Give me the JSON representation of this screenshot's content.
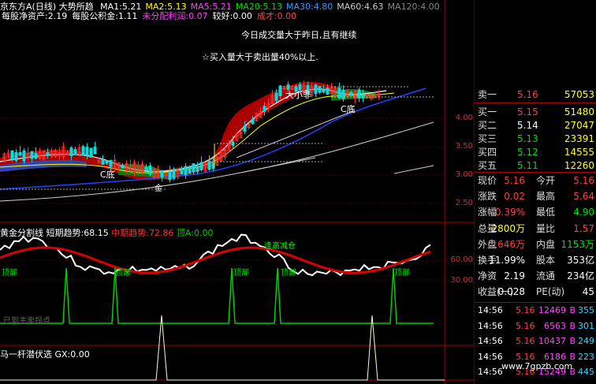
{
  "header": {
    "name": "京东方A(日线)",
    "trend": "大势所趋",
    "ma": [
      {
        "label": "MA1:",
        "value": "5.21",
        "color": "#ffffff"
      },
      {
        "label": "MA2:",
        "value": "5.13",
        "color": "#ffff00"
      },
      {
        "label": "MA5:",
        "value": "5.21",
        "color": "#ff44ff"
      },
      {
        "label": "MA20:",
        "value": "5.13",
        "color": "#00dd00"
      },
      {
        "label": "MA30:",
        "value": "4.80",
        "color": "#3399ff"
      },
      {
        "label": "MA60:",
        "value": "4.63",
        "color": "#cccccc"
      },
      {
        "label": "MA120:",
        "value": "4.00",
        "color": "#888888"
      }
    ],
    "row2": [
      {
        "label": "每股净资产:",
        "value": "2.19",
        "color": "#ffffff"
      },
      {
        "label": "每股公积金:",
        "value": "1.11",
        "color": "#ffffff"
      },
      {
        "label": "未分配利润:",
        "value": "0.07",
        "color": "#ff44ff"
      },
      {
        "label": "较好:",
        "value": "0.00",
        "color": "#ffffff"
      },
      {
        "label": "成才:",
        "value": "0.00",
        "color": "#ff4444"
      }
    ]
  },
  "annotations": {
    "volume_note": "今日成交量大于昨日,且有继续",
    "buy_note": "☆买入量大于卖出量40%以上.",
    "bigbig": "大小非",
    "c_bottom": "C底",
    "gold": "金"
  },
  "price_ticks": [
    "4.00",
    "3.50",
    "3.00",
    "2.50"
  ],
  "indicator": {
    "title": "黄金分割线",
    "trend_label": "短期趋势:",
    "trend_value": "68.15",
    "mid_label": "中期趋势:",
    "mid_value": "72.86",
    "top_label": "顶A:",
    "top_value": "0.00",
    "top_marker": "顶部",
    "ticks": [
      "60.00",
      "30.00"
    ],
    "note": "已到主卖拐点",
    "note2": "逢高减仓"
  },
  "indicator2": {
    "title": "马一杆潜伏选",
    "gx_label": "GX:",
    "gx_value": "0.00"
  },
  "quote": {
    "sell1": {
      "label": "卖一",
      "price": "5.16",
      "vol": "57053"
    },
    "buy": [
      {
        "label": "买一",
        "price": "5.15",
        "vol": "51480"
      },
      {
        "label": "买二",
        "price": "5.14",
        "vol": "27047"
      },
      {
        "label": "买三",
        "price": "5.13",
        "vol": "23391"
      },
      {
        "label": "买四",
        "price": "5.12",
        "vol": "14555"
      },
      {
        "label": "买五",
        "price": "5.11",
        "vol": "12260"
      }
    ],
    "stats": [
      {
        "l1": "现价",
        "v1": "5.16",
        "c1": "red",
        "l2": "今开",
        "v2": "5.16",
        "c2": "red"
      },
      {
        "l1": "涨跌",
        "v1": "0.02",
        "c1": "red",
        "l2": "最高",
        "v2": "5.64",
        "c2": "red"
      },
      {
        "l1": "涨幅",
        "v1": "0.39%",
        "c1": "red",
        "l2": "最低",
        "v2": "4.90",
        "c2": "green"
      },
      {
        "l1": "总量",
        "v1": "2800万",
        "c1": "yellow",
        "l2": "量比",
        "v2": "1.57",
        "c2": "red"
      },
      {
        "l1": "外盘",
        "v1": "1646万",
        "c1": "red",
        "l2": "内盘",
        "v2": "1153万",
        "c2": "green"
      },
      {
        "l1": "换手",
        "v1": "11.99%",
        "c1": "white",
        "l2": "股本",
        "v2": "353亿",
        "c2": "white"
      },
      {
        "l1": "净资",
        "v1": "2.19",
        "c1": "white",
        "l2": "流通",
        "v2": "234亿",
        "c2": "white"
      },
      {
        "l1": "收益(一)",
        "v1": "0.028",
        "c1": "white",
        "l2": "PE(动)",
        "v2": "45",
        "c2": "white"
      }
    ],
    "trades": [
      {
        "time": "14:56",
        "price": "5.16",
        "vol": "12469",
        "dir": "B",
        "n": "355"
      },
      {
        "time": "14:56",
        "price": "5.16",
        "vol": "6563",
        "dir": "B",
        "n": "301"
      },
      {
        "time": "14:56",
        "price": "5.16",
        "vol": "10437",
        "dir": "B",
        "n": "249"
      },
      {
        "time": "14:56",
        "price": "5.16",
        "vol": "6186",
        "dir": "B",
        "n": "223"
      },
      {
        "time": "14:56",
        "price": "5.16",
        "vol": "15249",
        "dir": "B",
        "n": "445"
      }
    ]
  },
  "watermark": "www.7gpzb.com"
}
